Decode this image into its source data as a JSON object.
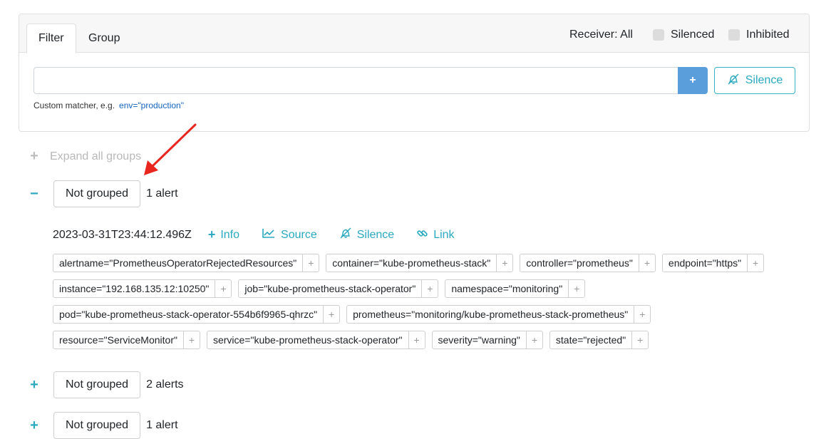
{
  "filter_panel": {
    "tabs": [
      "Filter",
      "Group"
    ],
    "receiver_label": "Receiver: All",
    "silenced_label": "Silenced",
    "inhibited_label": "Inhibited",
    "input_value": "",
    "add_button_label": "+",
    "silence_button_label": "Silence",
    "matcher_hint": "Custom matcher, e.g.",
    "matcher_example": "env=\"production\""
  },
  "expand_all": {
    "symbol": "+",
    "label": "Expand all groups"
  },
  "groups": [
    {
      "toggle": "−",
      "name": "Not grouped",
      "count": "1 alert"
    },
    {
      "toggle": "+",
      "name": "Not grouped",
      "count": "2 alerts"
    },
    {
      "toggle": "+",
      "name": "Not grouped",
      "count": "1 alert"
    }
  ],
  "alert": {
    "timestamp": "2023-03-31T23:44:12.496Z",
    "actions": {
      "info": "Info",
      "source": "Source",
      "silence": "Silence",
      "link": "Link"
    },
    "label_add_symbol": "+",
    "label_rows": [
      [
        "alertname=\"PrometheusOperatorRejectedResources\"",
        "container=\"kube-prometheus-stack\"",
        "controller=\"prometheus\"",
        "endpoint=\"https\""
      ],
      [
        "instance=\"192.168.135.12:10250\"",
        "job=\"kube-prometheus-stack-operator\"",
        "namespace=\"monitoring\""
      ],
      [
        "pod=\"kube-prometheus-stack-operator-554b6f9965-qhrzc\"",
        "prometheus=\"monitoring/kube-prometheus-stack-prometheus\""
      ],
      [
        "resource=\"ServiceMonitor\"",
        "service=\"kube-prometheus-stack-operator\"",
        "severity=\"warning\"",
        "state=\"rejected\""
      ]
    ]
  },
  "colors": {
    "accent": "#2aa8c1",
    "primary_button": "#5a9fdc",
    "annotation_arrow": "#e8261f"
  }
}
